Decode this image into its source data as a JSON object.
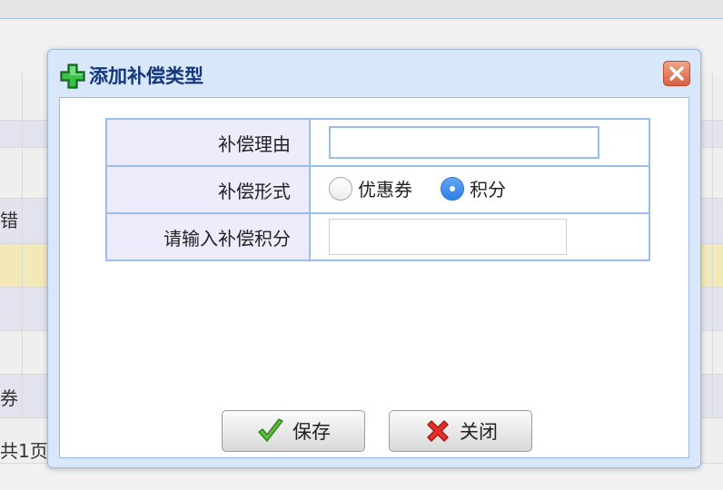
{
  "background": {
    "row_texts": [
      "错",
      "券",
      "共1页"
    ]
  },
  "dialog": {
    "title": "添加补偿类型",
    "icons": {
      "title": "plus-icon",
      "close": "close-icon"
    },
    "form": {
      "reason_label": "补偿理由",
      "reason_value": "",
      "form_label": "补偿形式",
      "options": [
        "优惠券",
        "积分"
      ],
      "selected_option": "积分",
      "points_label": "请输入补偿积分",
      "points_value": ""
    },
    "buttons": {
      "save_label": "保存",
      "close_label": "关闭",
      "save_icon": "check-icon",
      "close_icon": "cross-icon"
    }
  },
  "colors": {
    "header_text": "#15377c",
    "border": "#9bbde8",
    "label_bg": "#ececfc",
    "radio_selected": "#2c7fe6"
  }
}
